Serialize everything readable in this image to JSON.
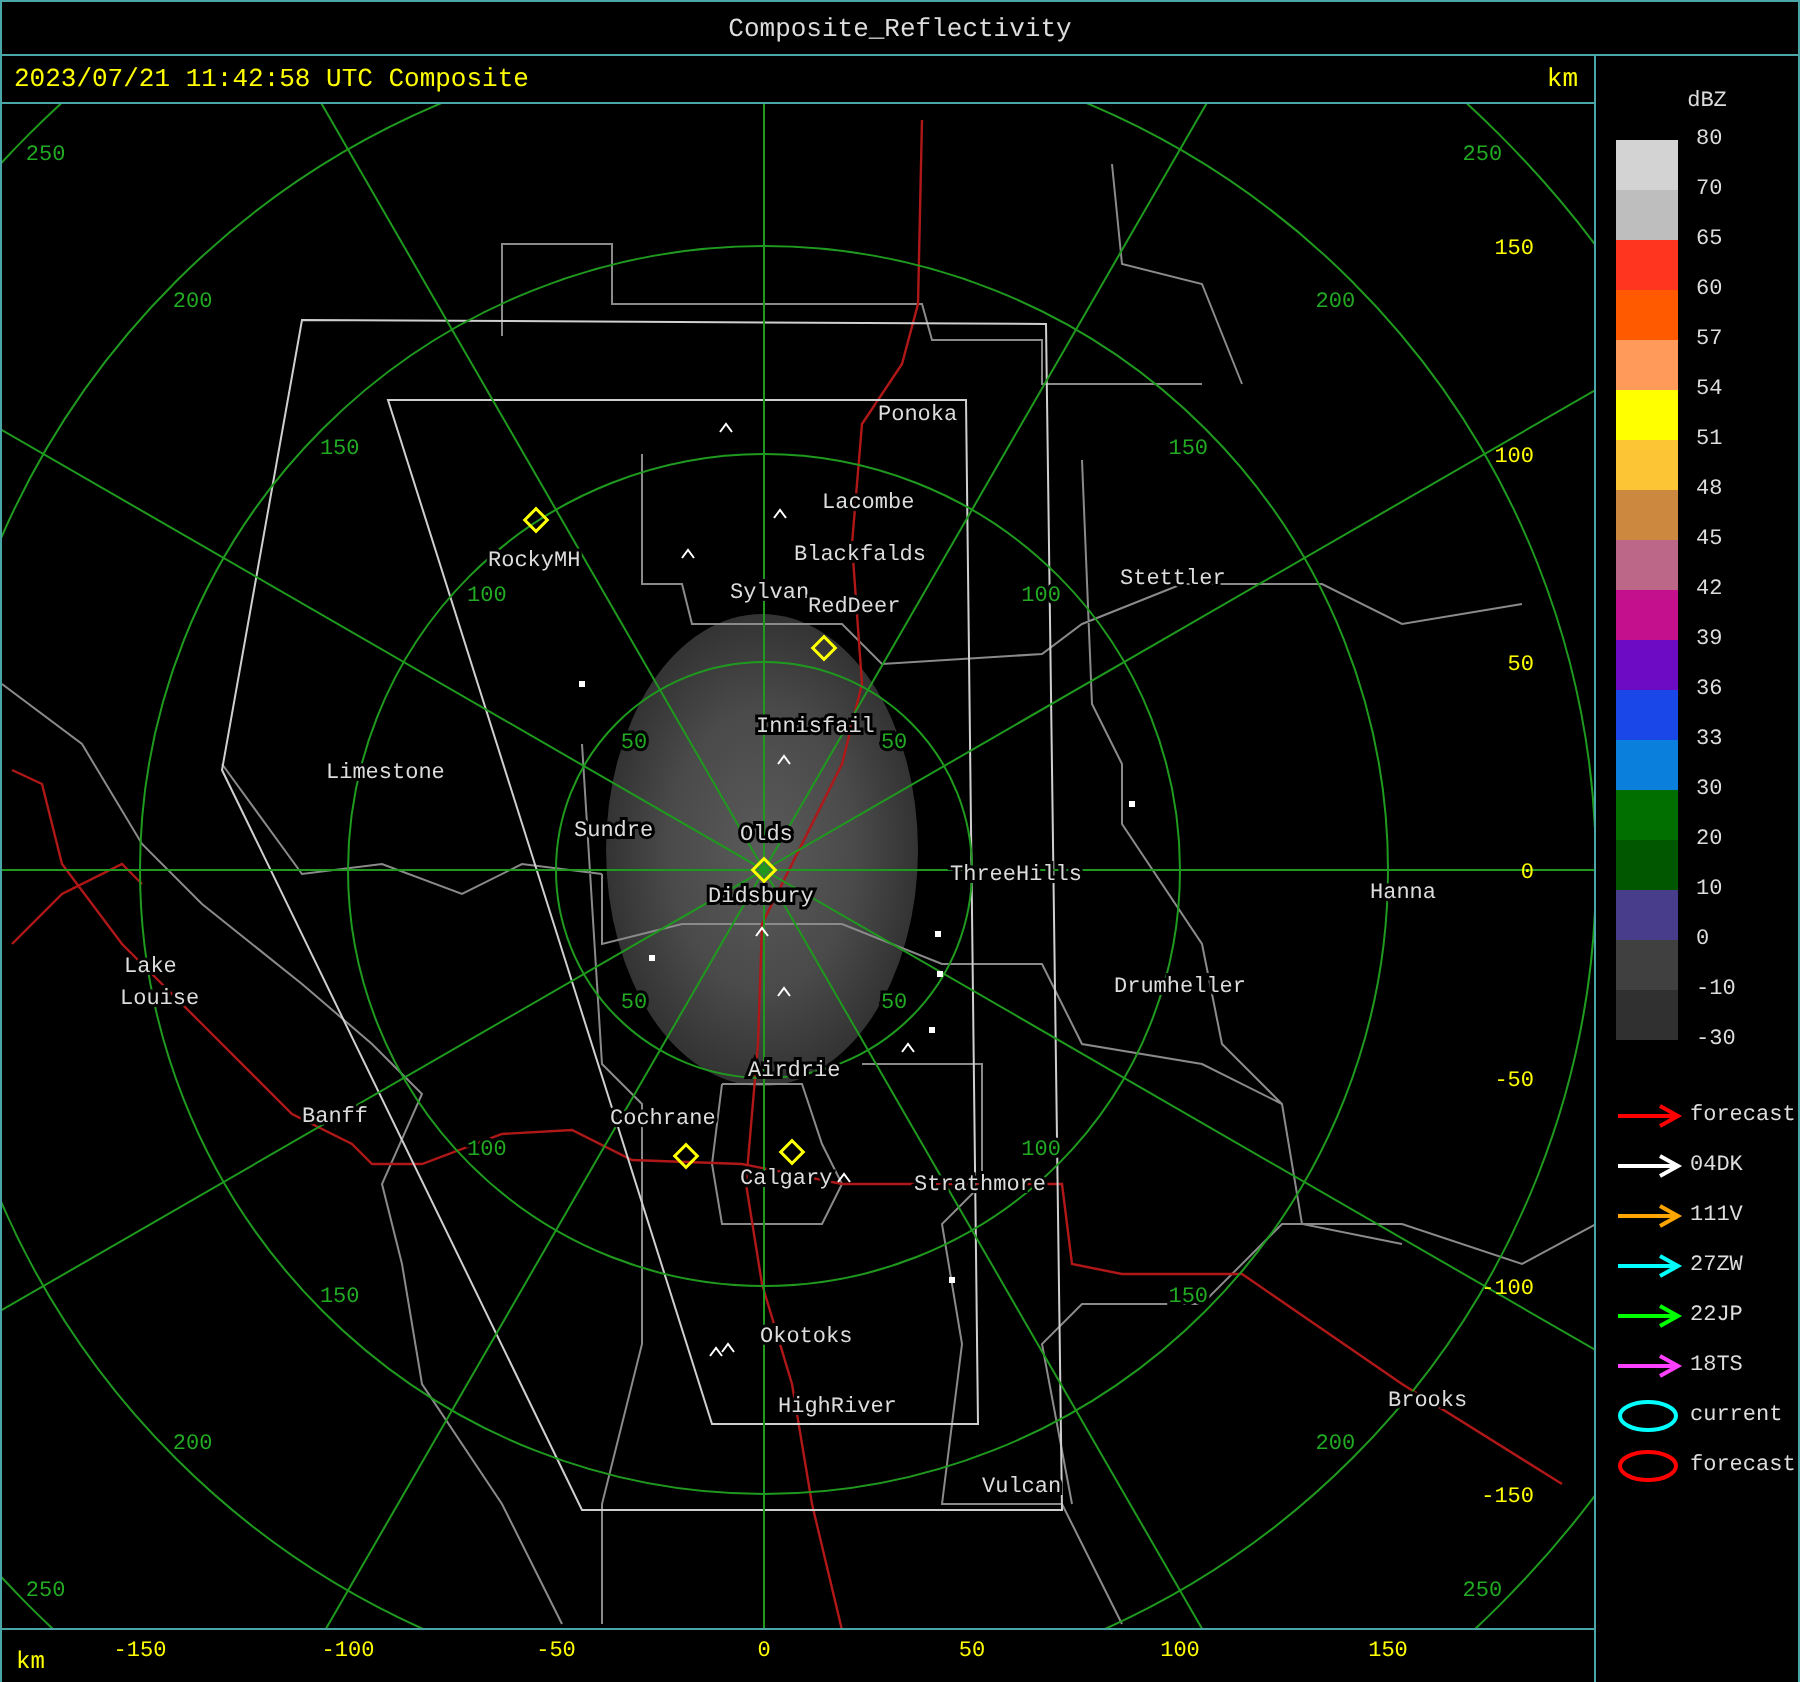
{
  "window": {
    "title": "Composite_Reflectivity"
  },
  "header": {
    "timestamp": "2023/07/21 11:42:58 UTC Composite",
    "unit": "km"
  },
  "map": {
    "ring_labels": [
      [
        "50",
        "50",
        "50",
        "50"
      ],
      [
        "100",
        "100",
        "100",
        "100"
      ],
      [
        "150",
        "150",
        "150",
        "150"
      ],
      [
        "200",
        "200",
        "200",
        "200"
      ],
      [
        "250",
        "250",
        "250",
        "250"
      ]
    ],
    "cities": [
      "Ponoka",
      "Lacombe",
      "Blackfalds",
      "Stettler",
      "Sylvan",
      "RockyMH",
      "RedDeer",
      "Innisfail",
      "Limestone",
      "Sundre",
      "Olds",
      "ThreeHills",
      "Hanna",
      "Didsbury",
      "Lake",
      "Louise",
      "Drumheller",
      "Airdrie",
      "Banff",
      "Cochrane",
      "Calgary",
      "Strathmore",
      "Okotoks",
      "Brooks",
      "HighRiver",
      "Vulcan"
    ],
    "y_axis": [
      "150",
      "100",
      "50",
      "0",
      "-50",
      "-100",
      "-150"
    ]
  },
  "x_axis": {
    "unit": "km",
    "labels": [
      "-150",
      "-100",
      "-50",
      "0",
      "50",
      "100",
      "150"
    ]
  },
  "legend": {
    "unit": "dBZ",
    "bins": [
      {
        "label": "80",
        "color": "#d3d3d3"
      },
      {
        "label": "70",
        "color": "#bebebe"
      },
      {
        "label": "65",
        "color": "#ff3520"
      },
      {
        "label": "60",
        "color": "#ff5a00"
      },
      {
        "label": "57",
        "color": "#ff9a5a"
      },
      {
        "label": "54",
        "color": "#ffff00"
      },
      {
        "label": "51",
        "color": "#fcc535"
      },
      {
        "label": "48",
        "color": "#cd8840"
      },
      {
        "label": "45",
        "color": "#bd6788"
      },
      {
        "label": "42",
        "color": "#c4108c"
      },
      {
        "label": "39",
        "color": "#6c0ac4"
      },
      {
        "label": "36",
        "color": "#1a48e8"
      },
      {
        "label": "33",
        "color": "#0a80dc"
      },
      {
        "label": "30",
        "color": "#006f00"
      },
      {
        "label": "20",
        "color": "#005700"
      },
      {
        "label": "10",
        "color": "#483d8b"
      },
      {
        "label": "0",
        "color": "#404040"
      },
      {
        "label": "-10",
        "color": "#303030"
      }
    ],
    "bottom_label": "-30"
  },
  "tracks": [
    {
      "kind": "arrow",
      "color": "#ff0000",
      "label": "forecast"
    },
    {
      "kind": "arrow",
      "color": "#ffffff",
      "label": "04DK"
    },
    {
      "kind": "arrow",
      "color": "#ffa500",
      "label": "111V"
    },
    {
      "kind": "arrow",
      "color": "#00ffff",
      "label": "27ZW"
    },
    {
      "kind": "arrow",
      "color": "#00ff00",
      "label": "22JP"
    },
    {
      "kind": "arrow",
      "color": "#ff40ff",
      "label": "18TS"
    },
    {
      "kind": "ellipse",
      "color": "#00ffff",
      "label": "current"
    },
    {
      "kind": "ellipse",
      "color": "#ff0000",
      "label": "forecast"
    }
  ]
}
